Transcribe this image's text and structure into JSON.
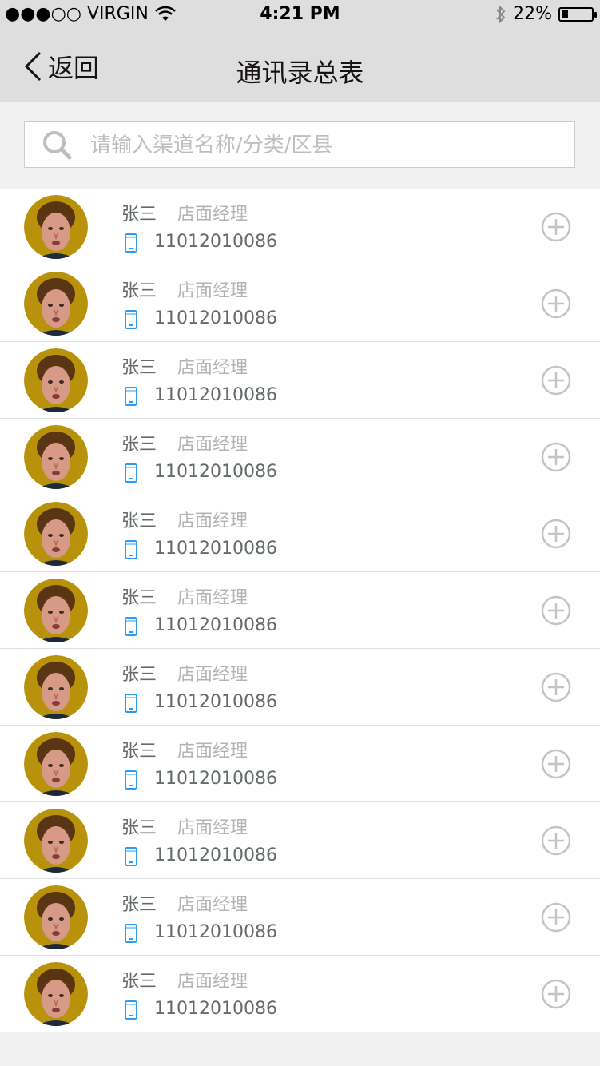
{
  "status_bar": {
    "carrier": "●●●○○ VIRGIN",
    "time": "4:21 PM",
    "battery": "22%",
    "battery_level": 0.22
  },
  "nav": {
    "back_label": "返回",
    "title": "通讯录总表"
  },
  "search": {
    "placeholder": "请输入渠道名称/分类/区县",
    "value": ""
  },
  "colors": {
    "border": "#cccccc",
    "background": "#ffffff",
    "role_text": "#b4b4b4",
    "placeholder": "#bfbfbf",
    "secondary_text": "#656b6c",
    "primary_text": "#171313",
    "phone_icon": "#2d9cf0",
    "add_icon": "#c4c4c4"
  },
  "contacts": [
    {
      "name": "张三",
      "role": "店面经理",
      "phone": "11012010086"
    },
    {
      "name": "张三",
      "role": "店面经理",
      "phone": "11012010086"
    },
    {
      "name": "张三",
      "role": "店面经理",
      "phone": "11012010086"
    },
    {
      "name": "张三",
      "role": "店面经理",
      "phone": "11012010086"
    },
    {
      "name": "张三",
      "role": "店面经理",
      "phone": "11012010086"
    },
    {
      "name": "张三",
      "role": "店面经理",
      "phone": "11012010086"
    },
    {
      "name": "张三",
      "role": "店面经理",
      "phone": "11012010086"
    },
    {
      "name": "张三",
      "role": "店面经理",
      "phone": "11012010086"
    },
    {
      "name": "张三",
      "role": "店面经理",
      "phone": "11012010086"
    },
    {
      "name": "张三",
      "role": "店面经理",
      "phone": "11012010086"
    },
    {
      "name": "张三",
      "role": "店面经理",
      "phone": "11012010086"
    }
  ],
  "icons": {
    "back": "chevron-left-icon",
    "search": "search-icon",
    "phone": "mobile-phone-icon",
    "add": "plus-circle-icon",
    "wifi": "wifi-icon",
    "bluetooth": "bluetooth-icon",
    "battery": "battery-icon"
  }
}
